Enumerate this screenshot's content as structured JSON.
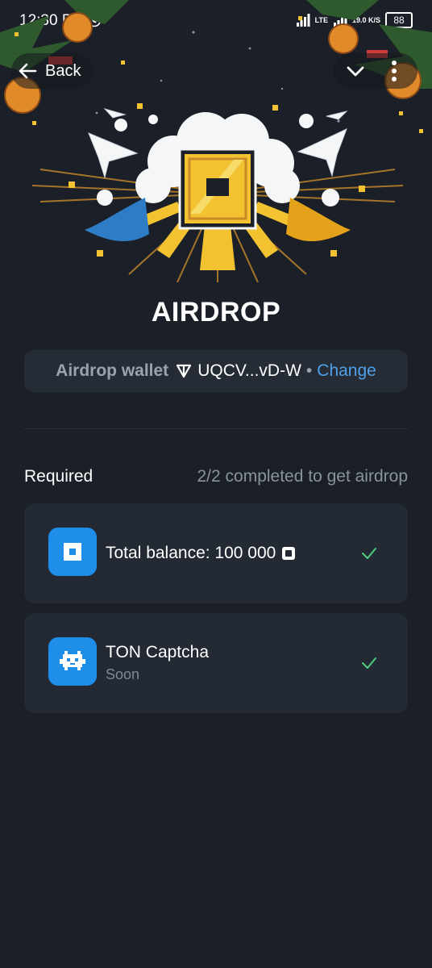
{
  "status_bar": {
    "time": "12:30 PM",
    "network": "LTE",
    "speed": "19.0 K/S",
    "battery": "88"
  },
  "nav": {
    "back_label": "Back",
    "icons": [
      "arrow-left-icon",
      "chevron-down-icon",
      "more-vertical-icon"
    ]
  },
  "page": {
    "title": "AIRDROP"
  },
  "wallet": {
    "label": "Airdrop wallet",
    "address": "UQCV...vD-W",
    "separator": "•",
    "change_label": "Change"
  },
  "requirements": {
    "label": "Required",
    "status": "2/2 completed to get airdrop",
    "tasks": [
      {
        "title": "Total balance: 100 000",
        "subtitle": "",
        "icon": "coin-icon",
        "completed": true
      },
      {
        "title": "TON Captcha",
        "subtitle": "Soon",
        "icon": "pixel-creature-icon",
        "completed": true
      }
    ]
  },
  "colors": {
    "background": "#1b2028",
    "card": "#232a34",
    "accent_blue": "#1e8ee8",
    "link_blue": "#4ea0e8",
    "check_green": "#4cd07d",
    "coin_gold": "#f2c230"
  }
}
